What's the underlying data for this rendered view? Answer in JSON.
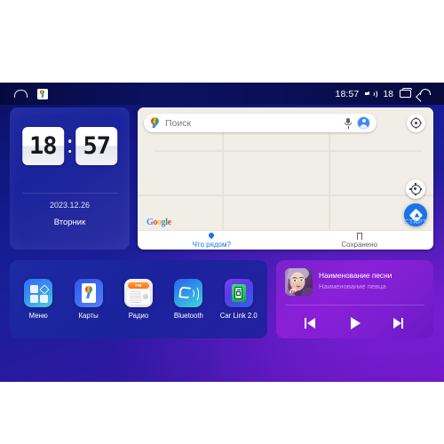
{
  "status_bar": {
    "home_icon": "home-icon",
    "maps_icon": "google-maps-icon",
    "time": "18:57",
    "volume_icon": "volume-icon",
    "volume_level": "18",
    "recents_icon": "recents-icon",
    "back_icon": "back-icon"
  },
  "clock_widget": {
    "hours": "18",
    "minutes": "57",
    "date": "2023.12.26",
    "weekday": "Вторник"
  },
  "map_widget": {
    "search": {
      "placeholder": "Поиск",
      "pin_icon": "google-maps-pin-icon",
      "mic_icon": "microphone-icon",
      "avatar_icon": "account-avatar-icon"
    },
    "settings_chip_icon": "compass-settings-icon",
    "my_location_icon": "my-location-icon",
    "start_button": {
      "icon": "navigation-diamond-icon",
      "label": "СТАРТ"
    },
    "brand": {
      "g1": "G",
      "g2": "o",
      "g3": "o",
      "g4": "g",
      "g5": "l",
      "g6": "e"
    },
    "tabs": [
      {
        "label": "Что рядом?",
        "icon": "location-pin-icon",
        "active": true
      },
      {
        "label": "Сохранено",
        "icon": "bookmark-icon",
        "active": false
      }
    ]
  },
  "app_dock": {
    "apps": [
      {
        "label": "Меню",
        "icon": "menu-grid-icon"
      },
      {
        "label": "Карты",
        "icon": "maps-icon"
      },
      {
        "label": "Радио",
        "icon": "radio-icon",
        "band": "FM"
      },
      {
        "label": "Bluetooth",
        "icon": "bluetooth-phone-icon"
      },
      {
        "label": "Car Link 2.0",
        "icon": "car-link-icon"
      }
    ]
  },
  "media_widget": {
    "album_art": "album-art-portrait",
    "title": "Наименование песни",
    "artist": "Наименование певца",
    "controls": [
      {
        "name": "previous-track-button",
        "icon": "skip-previous-icon"
      },
      {
        "name": "play-button",
        "icon": "play-icon"
      },
      {
        "name": "next-track-button",
        "icon": "skip-next-icon"
      }
    ]
  },
  "colors": {
    "background_blue": "#1a1f9a",
    "background_purple": "#6a0fc0",
    "accent_blue": "#1a73e8",
    "map_surface": "#f1eee7",
    "media_purple": "#8b1fd8"
  }
}
